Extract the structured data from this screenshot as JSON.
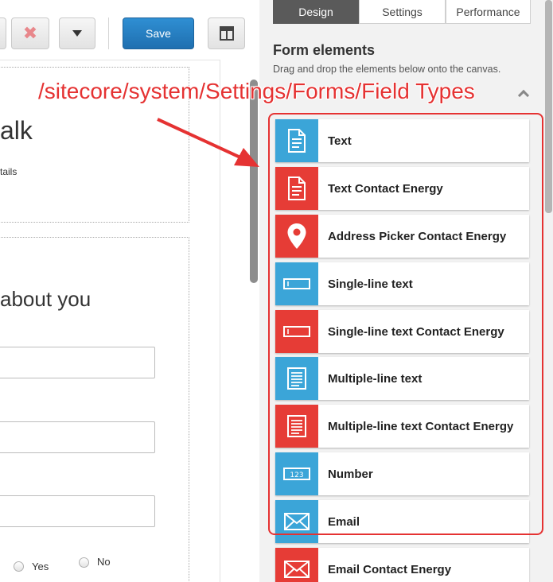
{
  "toolbar": {
    "delete_glyph": "✖",
    "save_label": "Save"
  },
  "canvas": {
    "title_fragment": "alk",
    "subtitle_fragment": "tails",
    "section_title_fragment": "about you",
    "radio_options": [
      "Yes",
      "No"
    ]
  },
  "panel": {
    "tabs": [
      {
        "label": "Design",
        "active": true
      },
      {
        "label": "Settings",
        "active": false
      },
      {
        "label": "Performance",
        "active": false
      }
    ],
    "heading": "Form elements",
    "description": "Drag and drop the elements below onto the canvas.",
    "fields": [
      {
        "label": "Text",
        "icon": "document-icon",
        "color": "blue"
      },
      {
        "label": "Text Contact Energy",
        "icon": "document-icon",
        "color": "red"
      },
      {
        "label": "Address Picker Contact Energy",
        "icon": "map-pin-icon",
        "color": "red"
      },
      {
        "label": "Single-line text",
        "icon": "text-input-icon",
        "color": "blue"
      },
      {
        "label": "Single-line text Contact Energy",
        "icon": "text-input-icon",
        "color": "red"
      },
      {
        "label": "Multiple-line text",
        "icon": "textarea-icon",
        "color": "blue"
      },
      {
        "label": "Multiple-line text Contact Energy",
        "icon": "textarea-icon",
        "color": "red"
      },
      {
        "label": "Number",
        "icon": "number-icon",
        "color": "blue"
      },
      {
        "label": "Email",
        "icon": "envelope-icon",
        "color": "blue"
      },
      {
        "label": "Email Contact Energy",
        "icon": "envelope-icon",
        "color": "red"
      }
    ]
  },
  "annotation": {
    "text": "/sitecore/system/Settings/Forms/Field Types",
    "color": "#e53232"
  },
  "colors": {
    "blue": "#3ba5d8",
    "red": "#e63c36",
    "save_button": "#2b83c6",
    "active_tab": "#5a5a5a"
  }
}
